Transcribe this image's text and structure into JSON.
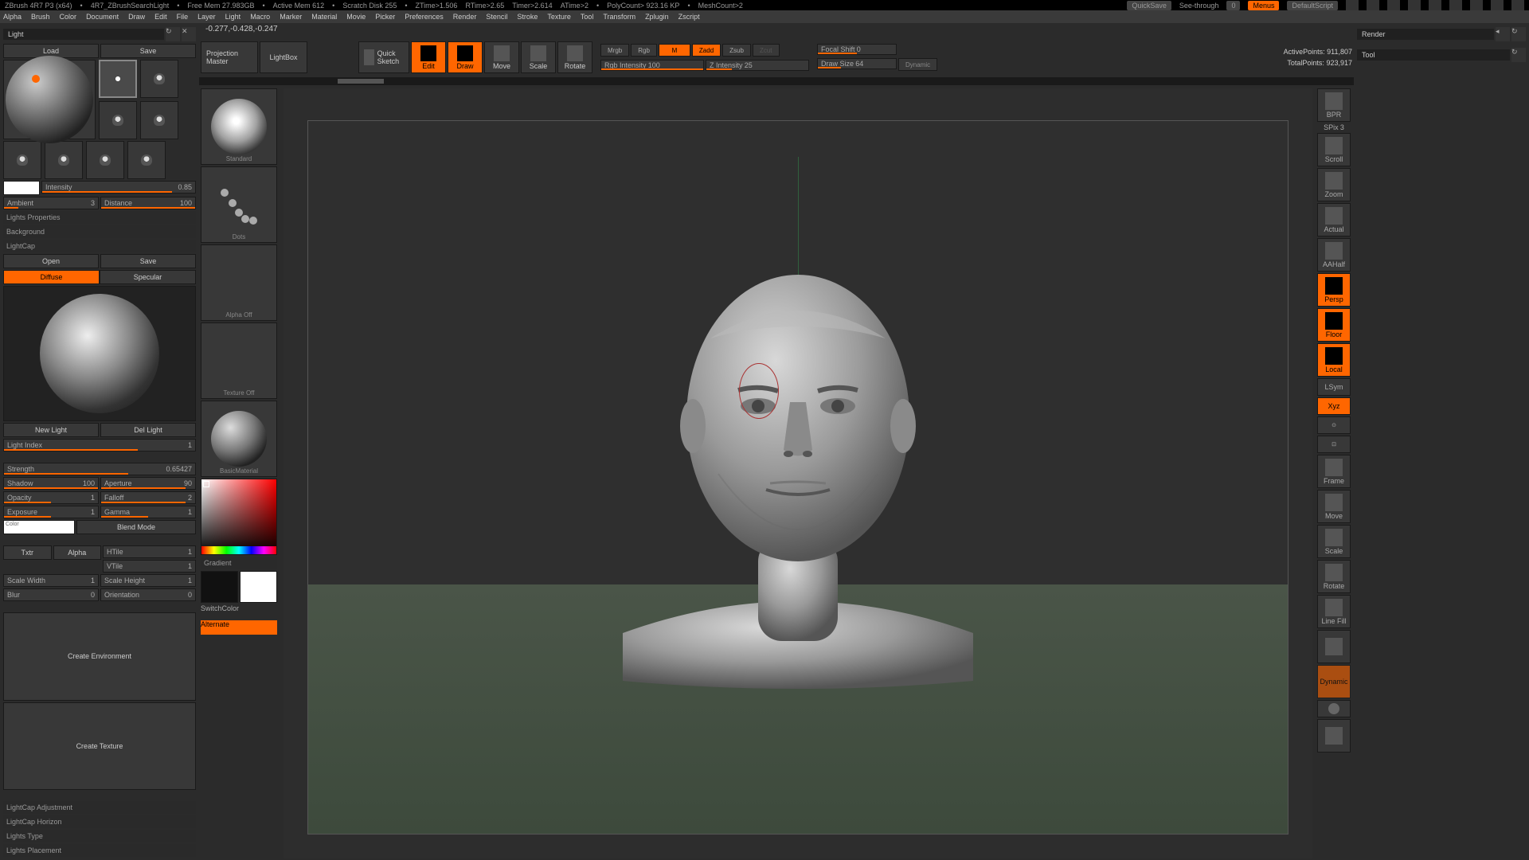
{
  "status": {
    "app": "ZBrush 4R7 P3 (x64)",
    "doc": "4R7_ZBrushSearchLight",
    "free_mem": "Free Mem 27.983GB",
    "active_mem": "Active Mem 612",
    "scratch": "Scratch Disk 255",
    "ztime": "ZTime>1.506",
    "rtime": "RTime>2.65",
    "timer": "Timer>2.614",
    "atime": "ATime>2",
    "polycount": "PolyCount> 923.16 KP",
    "mesh": "MeshCount>2",
    "quicksave": "QuickSave",
    "see_through": "See-through",
    "see_through_val": "0",
    "menus": "Menus",
    "default_script": "DefaultScript"
  },
  "menu": [
    "Alpha",
    "Brush",
    "Color",
    "Document",
    "Draw",
    "Edit",
    "File",
    "Layer",
    "Light",
    "Macro",
    "Marker",
    "Material",
    "Movie",
    "Picker",
    "Preferences",
    "Render",
    "Stencil",
    "Stroke",
    "Texture",
    "Tool",
    "Transform",
    "Zplugin",
    "Zscript"
  ],
  "left_panel": {
    "title": "Light",
    "load": "Load",
    "save": "Save",
    "intensity_lbl": "Intensity",
    "intensity_val": "0.85",
    "ambient_lbl": "Ambient",
    "ambient_val": "3",
    "distance_lbl": "Distance",
    "distance_val": "100",
    "props": "Lights Properties",
    "background": "Background",
    "lightcap": "LightCap",
    "open": "Open",
    "save2": "Save",
    "diffuse": "Diffuse",
    "specular": "Specular",
    "new_light": "New Light",
    "del_light": "Del Light",
    "light_index_lbl": "Light Index",
    "light_index_val": "1",
    "strength_lbl": "Strength",
    "strength_val": "0.65427",
    "shadow_lbl": "Shadow",
    "shadow_val": "100",
    "aperture_lbl": "Aperture",
    "aperture_val": "90",
    "opacity_lbl": "Opacity",
    "opacity_val": "1",
    "falloff_lbl": "Falloff",
    "falloff_val": "2",
    "exposure_lbl": "Exposure",
    "exposure_val": "1",
    "gamma_lbl": "Gamma",
    "gamma_val": "1",
    "color_lbl": "Color",
    "blend_mode": "Blend Mode",
    "txtr": "Txtr",
    "alpha": "Alpha",
    "htile_lbl": "HTile",
    "htile_val": "1",
    "vtile_lbl": "VTile",
    "vtile_val": "1",
    "scalew_lbl": "Scale Width",
    "scalew_val": "1",
    "scaleh_lbl": "Scale Height",
    "scaleh_val": "1",
    "blur_lbl": "Blur",
    "blur_val": "0",
    "orient_lbl": "Orientation",
    "orient_val": "0",
    "create_env": "Create Environment",
    "create_tex": "Create Texture",
    "lc_adjust": "LightCap Adjustment",
    "lc_horizon": "LightCap Horizon",
    "lights_type": "Lights Type",
    "lights_placement": "Lights Placement"
  },
  "coord": "-0.277,-0.428,-0.247",
  "toolbar": {
    "proj": "Projection Master",
    "lightbox": "LightBox",
    "quicksketch": "Quick Sketch",
    "edit": "Edit",
    "draw": "Draw",
    "move": "Move",
    "scale": "Scale",
    "rotate": "Rotate",
    "mrgb": "Mrgb",
    "rgb": "Rgb",
    "m": "M",
    "zadd": "Zadd",
    "zsub": "Zsub",
    "zcut": "Zcut",
    "rgb_int_lbl": "Rgb Intensity",
    "rgb_int_val": "100",
    "z_int_lbl": "Z Intensity",
    "z_int_val": "25",
    "focal_lbl": "Focal Shift",
    "focal_val": "0",
    "draw_size_lbl": "Draw Size",
    "draw_size_val": "64",
    "dynamic": "Dynamic",
    "active_pts_lbl": "ActivePoints:",
    "active_pts_val": "911,807",
    "total_pts_lbl": "TotalPoints:",
    "total_pts_val": "923,917"
  },
  "shelf": {
    "brush": "Standard",
    "stroke": "Dots",
    "alpha": "Alpha Off",
    "texture": "Texture Off",
    "material": "BasicMaterial",
    "gradient": "Gradient",
    "switchcolor": "SwitchColor",
    "alternate": "Alternate"
  },
  "right_panel": {
    "title": "Render",
    "tool": "Tool",
    "spix_lbl": "SPix",
    "spix_val": "3"
  },
  "right_icons": [
    "BPR",
    "Scroll",
    "Zoom",
    "Actual",
    "AAHalf",
    "Persp",
    "Floor",
    "Local",
    "LSym",
    "Xyz",
    "",
    "",
    "Frame",
    "Move",
    "Scale",
    "Rotate",
    "Line Fill",
    "",
    "Dynamic",
    "Solo",
    ""
  ]
}
